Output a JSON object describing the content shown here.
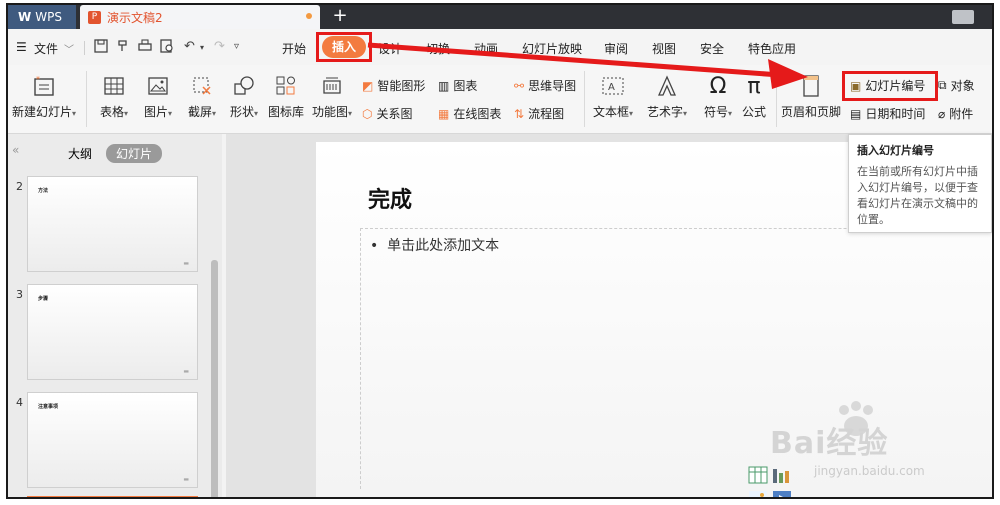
{
  "titlebar": {
    "app_label": "WPS",
    "doc_tab_icon": "P",
    "doc_tab_name": "演示文稿2",
    "new_tab": "+"
  },
  "menubar": {
    "file_label": "文件",
    "tabs": [
      "开始",
      "插入",
      "设计",
      "切换",
      "动画",
      "幻灯片放映",
      "审阅",
      "视图",
      "安全",
      "特色应用"
    ],
    "active_tab": "插入"
  },
  "ribbon": {
    "new_slide": "新建幻灯片",
    "table": "表格",
    "picture": "图片",
    "screenshot": "截屏",
    "shape": "形状",
    "icon_library": "图标库",
    "function_chart": "功能图",
    "smart_art": "智能图形",
    "chart": "图表",
    "relation_chart": "关系图",
    "online_chart": "在线图表",
    "mind_map": "思维导图",
    "flowchart": "流程图",
    "textbox": "文本框",
    "word_art": "艺术字",
    "symbol": "符号",
    "formula": "公式",
    "header_footer": "页眉和页脚",
    "slide_number": "幻灯片编号",
    "object": "对象",
    "date_time": "日期和时间",
    "attachment": "附件"
  },
  "left_pane": {
    "tab_outline": "大纲",
    "tab_slides": "幻灯片",
    "slides": [
      {
        "number": "2",
        "title": "方法"
      },
      {
        "number": "3",
        "title": "步骤"
      },
      {
        "number": "4",
        "title": "注意事项"
      }
    ]
  },
  "slide": {
    "title": "完成",
    "body_placeholder": "单击此处添加文本"
  },
  "tooltip": {
    "title": "插入幻灯片编号",
    "text": "在当前或所有幻灯片中插入幻灯片编号，以便于查看幻灯片在演示文稿中的位置。"
  },
  "watermark": {
    "main": "Bai经验",
    "sub": "jingyan.baidu.com"
  },
  "colors": {
    "accent": "#f37b40",
    "highlight": "#e51a1a",
    "wps_tab": "#3f5a7f"
  }
}
